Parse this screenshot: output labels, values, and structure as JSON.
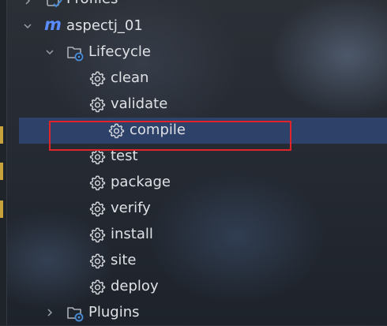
{
  "tree": {
    "profiles_label": "Profiles",
    "project": {
      "label": "aspectj_01",
      "icon": "maven-m-icon"
    },
    "lifecycle": {
      "label": "Lifecycle",
      "items": [
        "clean",
        "validate",
        "compile",
        "test",
        "package",
        "verify",
        "install",
        "site",
        "deploy"
      ],
      "selected": "compile"
    },
    "plugins_label": "Plugins"
  },
  "colors": {
    "selection": "#2e436e",
    "highlight_box": "#e0242a",
    "maven_icon": "#5b8cff",
    "gear_icon": "#d6d8dc",
    "folder_icon": "#aab0b8",
    "folder_badge": "#4a8bd6"
  }
}
